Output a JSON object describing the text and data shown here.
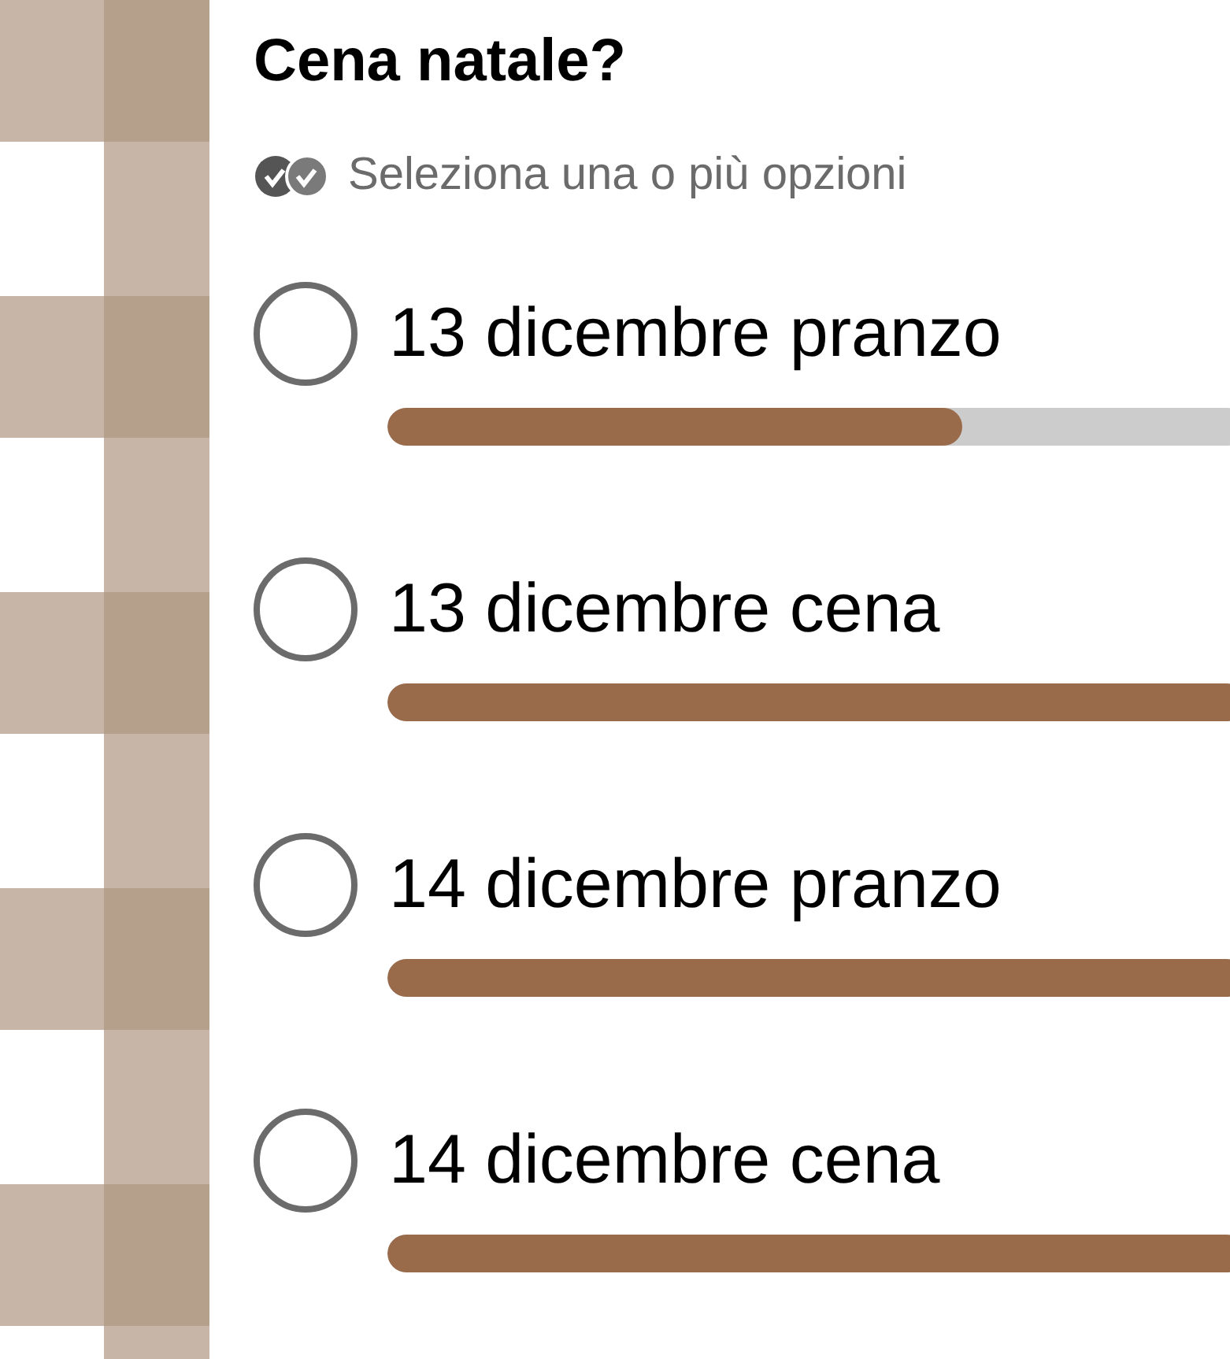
{
  "poll": {
    "title": "Cena natale?",
    "subtitle": "Seleziona una o più opzioni",
    "options": [
      {
        "label": "13 dicembre pranzo",
        "selected": false,
        "level": 0.67
      },
      {
        "label": "13 dicembre cena",
        "selected": false,
        "level": 1
      },
      {
        "label": "14 dicembre pranzo",
        "selected": false,
        "level": 1
      },
      {
        "label": "14 dicembre cena",
        "selected": false,
        "level": 1
      }
    ]
  }
}
